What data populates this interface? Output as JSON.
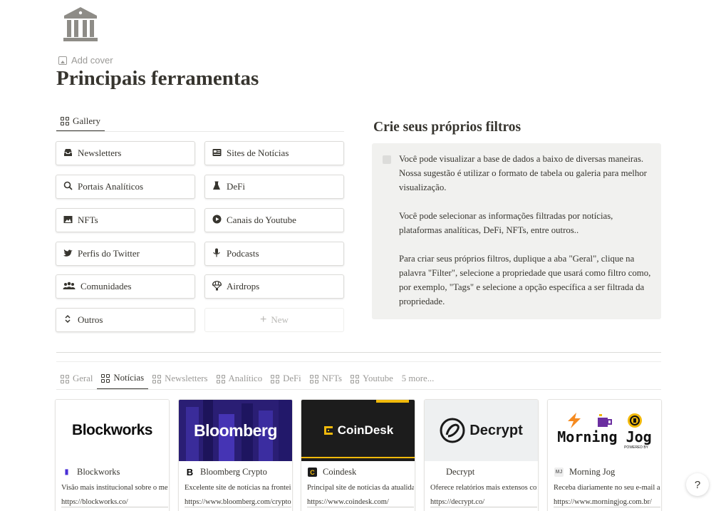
{
  "page": {
    "icon": "bank-building-icon",
    "add_cover": "Add cover",
    "title": "Principais ferramentas"
  },
  "gallery_view": {
    "tab_label": "Gallery",
    "cards": [
      {
        "label": "Newsletters",
        "icon": "inbox-tray-icon"
      },
      {
        "label": "Sites de Notícias",
        "icon": "newspaper-icon"
      },
      {
        "label": "Portais Analíticos",
        "icon": "magnifier-icon"
      },
      {
        "label": "DeFi",
        "icon": "flask-icon"
      },
      {
        "label": "NFTs",
        "icon": "picture-icon"
      },
      {
        "label": "Canais do Youtube",
        "icon": "play-circle-icon"
      },
      {
        "label": "Perfis do Twitter",
        "icon": "bird-icon"
      },
      {
        "label": "Podcasts",
        "icon": "microphone-icon"
      },
      {
        "label": "Comunidades",
        "icon": "group-icon"
      },
      {
        "label": "Airdrops",
        "icon": "parachute-icon"
      },
      {
        "label": "Outros",
        "icon": "up-down-chevron-icon"
      }
    ],
    "new_label": "New"
  },
  "callout": {
    "title": "Crie seus próprios filtros",
    "paragraphs": [
      "Você pode visualizar a base de dados a baixo de diversas maneiras. Nossa sugestão é utilizar o formato de tabela ou galeria para melhor visualização.",
      "Você pode selecionar as informações filtradas por notícias, plataformas analíticas, DeFi, NFTs, entre outros..",
      "Para criar seus próprios filtros, duplique a aba \"Geral\", clique na palavra \"Filter\", selecione a propriedade que usará como filtro como, por exemplo, \"Tags\" e selecione a opção específica a ser filtrada da propriedade."
    ]
  },
  "database": {
    "tabs": [
      "Geral",
      "Notícias",
      "Newsletters",
      "Analítico",
      "DeFi",
      "NFTs",
      "Youtube"
    ],
    "active_tab": "Notícias",
    "more_label": "5 more...",
    "cards": [
      {
        "cover_text": "Blockworks",
        "title": "Blockworks",
        "desc": "Visão mais institucional sobre o mercado",
        "url": "https://blockworks.co/"
      },
      {
        "cover_text": "Bloomberg",
        "title": "Bloomberg Crypto",
        "desc": "Excelente site de notícias na fronteira",
        "url": "https://www.bloomberg.com/crypto"
      },
      {
        "cover_text": "CoinDesk",
        "title": "Coindesk",
        "desc": "Principal site de notícias da atualidade",
        "url": "https://www.coindesk.com/"
      },
      {
        "cover_text": "Decrypt",
        "title": "Decrypt",
        "desc": "Oferece relatórios mais extensos com",
        "url": "https://decrypt.co/"
      },
      {
        "cover_text": "Morning Jog",
        "cover_small": "POWERED BY",
        "title": "Morning Jog",
        "desc": "Receba diariamente no seu e-mail as",
        "url": "https://www.morningjog.com.br/"
      }
    ]
  },
  "help": {
    "label": "?"
  }
}
